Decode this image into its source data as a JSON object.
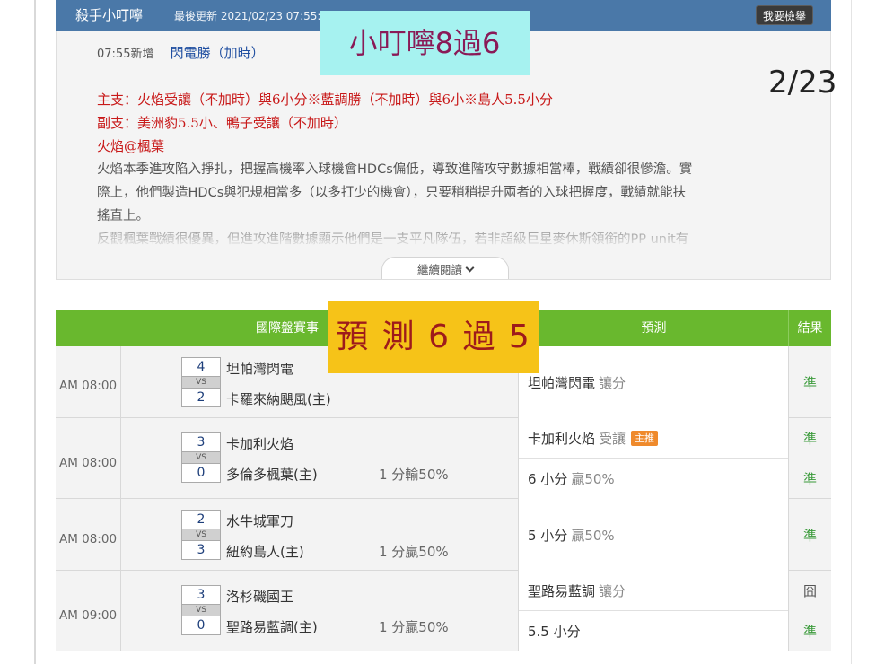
{
  "header": {
    "title": "殺手小叮嚀",
    "updated": "最後更新 2021/02/23 07:55:48",
    "report_button": "我要檢舉"
  },
  "article": {
    "new_time": "07:55新增",
    "new_title": "閃電勝（加時）",
    "main_pick": "主支：火焰受讓（不加時）與6小分※藍調勝（不加時）與6小※島人5.5小分",
    "side_pick": "副支：美洲豹5.5小、鴨子受讓（不加時）",
    "matchup": "火焰@楓葉",
    "body_lines": [
      "火焰本季進攻陷入掙扎，把握高機率入球機會HDCs偏低，導致進階攻守數據相當棒，戰績卻很慘澹。實",
      "際上，他們製造HDCs與犯規相當多（以多打少的機會），只要稍稍提升兩者的入球把握度，戰績就能扶",
      "搖直上。",
      "反觀楓葉戰績很優異，但進攻進階數據顯示他們是一支平凡隊伍，若非超級巨星麥休斯領銜的PP unit有"
    ],
    "continue_label": "繼續閱讀"
  },
  "overlays": {
    "top_note": "小叮嚀8過6",
    "mid_note": "預 測 6 過 5",
    "page": "2/23"
  },
  "table": {
    "headers": {
      "event": "國際盤賽事",
      "prediction": "預測",
      "result": "結果"
    },
    "rows": [
      {
        "time": "AM 08:00",
        "away_score": "4",
        "vs": "VS",
        "home_score": "2",
        "away_team": "坦帕灣閃電",
        "home_team": "卡羅來納颶風(主)",
        "line_result": "",
        "predictions": [
          {
            "team": "坦帕灣閃電",
            "note": "讓分",
            "badge": "",
            "result": "準"
          }
        ]
      },
      {
        "time": "AM 08:00",
        "away_score": "3",
        "vs": "VS",
        "home_score": "0",
        "away_team": "卡加利火焰",
        "home_team": "多倫多楓葉(主)",
        "line_result": "1 分輸50%",
        "predictions": [
          {
            "team": "卡加利火焰",
            "note": "受讓",
            "badge": "主推",
            "result": "準"
          },
          {
            "team": "6 小分",
            "note": "贏50%",
            "badge": "",
            "result": "準"
          }
        ]
      },
      {
        "time": "AM 08:00",
        "away_score": "2",
        "vs": "VS",
        "home_score": "3",
        "away_team": "水牛城軍刀",
        "home_team": "紐約島人(主)",
        "line_result": "1 分贏50%",
        "predictions": [
          {
            "team": "5 小分",
            "note": "贏50%",
            "badge": "",
            "result": "準"
          }
        ]
      },
      {
        "time": "AM 09:00",
        "away_score": "3",
        "vs": "VS",
        "home_score": "0",
        "away_team": "洛杉磯國王",
        "home_team": "聖路易藍調(主)",
        "line_result": "1 分贏50%",
        "predictions": [
          {
            "team": "聖路易藍調",
            "note": "讓分",
            "badge": "",
            "result": "囧"
          },
          {
            "team": "5.5 小分",
            "note": "",
            "badge": "",
            "result": "準"
          }
        ]
      }
    ]
  },
  "colors": {
    "header_blue": "#4a78a8",
    "table_green": "#69b82e",
    "pick_red": "#c81919",
    "result_green": "#3a9a3a",
    "badge_orange": "#ef8a2c"
  }
}
